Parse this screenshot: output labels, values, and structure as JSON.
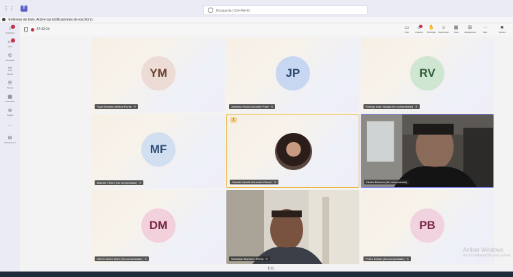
{
  "search": {
    "placeholder": "Búsqueda (Ctrl+Alt+E)"
  },
  "notification": {
    "text": "Entérese de todo. Active las notificaciones de escritorio."
  },
  "rail": [
    {
      "label": "Actividad",
      "icon": "bell-icon",
      "badge": true
    },
    {
      "label": "Chat",
      "icon": "chat-icon",
      "badge": true
    },
    {
      "label": "Llamadas",
      "icon": "phone-icon",
      "badge": false
    },
    {
      "label": "Teams",
      "icon": "teams-icon",
      "badge": false
    },
    {
      "label": "Tareas",
      "icon": "tasks-icon",
      "badge": false
    },
    {
      "label": "Calendario",
      "icon": "calendar-icon",
      "badge": false
    },
    {
      "label": "Copilot",
      "icon": "copilot-icon",
      "badge": false
    },
    {
      "label": "...",
      "icon": "more-icon",
      "badge": false
    },
    {
      "label": "Aplicaciones",
      "icon": "apps-icon",
      "badge": false
    }
  ],
  "meeting": {
    "timer": "37:42:24",
    "tools": [
      {
        "label": "Chat",
        "icon": "chat-icon"
      },
      {
        "label": "Usuarios",
        "icon": "people-icon"
      },
      {
        "label": "Participar",
        "icon": "raise-hand-icon"
      },
      {
        "label": "Reaccionar",
        "icon": "react-icon"
      },
      {
        "label": "Vista",
        "icon": "view-icon"
      },
      {
        "label": "Aplicaciones",
        "icon": "apps-icon"
      },
      {
        "label": "Más",
        "icon": "more-icon"
      },
      {
        "label": "Cámara",
        "icon": "camera-icon"
      }
    ]
  },
  "participants": [
    {
      "initials": "YM",
      "name": "Yuyci Deyana Medina Flores",
      "kind": "initials",
      "color": "ym"
    },
    {
      "initials": "JP",
      "name": "Johanna Paola Gonzalez Paez",
      "kind": "initials",
      "color": "jp"
    },
    {
      "initials": "RV",
      "name": "Rodrigo Avila Vargas (No comprobado)",
      "kind": "initials",
      "color": "rv"
    },
    {
      "initials": "MF",
      "name": "Marcelo Flórez (No comprobado)",
      "kind": "initials",
      "color": "mf"
    },
    {
      "initials": "",
      "name": "Claudia Yaneth Gonzalez Rincon",
      "kind": "photo",
      "color": ""
    },
    {
      "initials": "",
      "name": "Héctor Romero (No comprobado)",
      "kind": "video",
      "color": ""
    },
    {
      "initials": "DM",
      "name": "DIEGO MACHADO (No comprobado)",
      "kind": "initials",
      "color": "dm"
    },
    {
      "initials": "",
      "name": "Sebastián Martínez Rivera",
      "kind": "video",
      "color": ""
    },
    {
      "initials": "PB",
      "name": "Pedro Beltran (No comprobado)",
      "kind": "initials",
      "color": "pb"
    }
  ],
  "pager": "1/11",
  "watermark": {
    "title": "Activar Windows",
    "subtitle": "Ve a Configuración para activar"
  },
  "hand_badge": "1"
}
